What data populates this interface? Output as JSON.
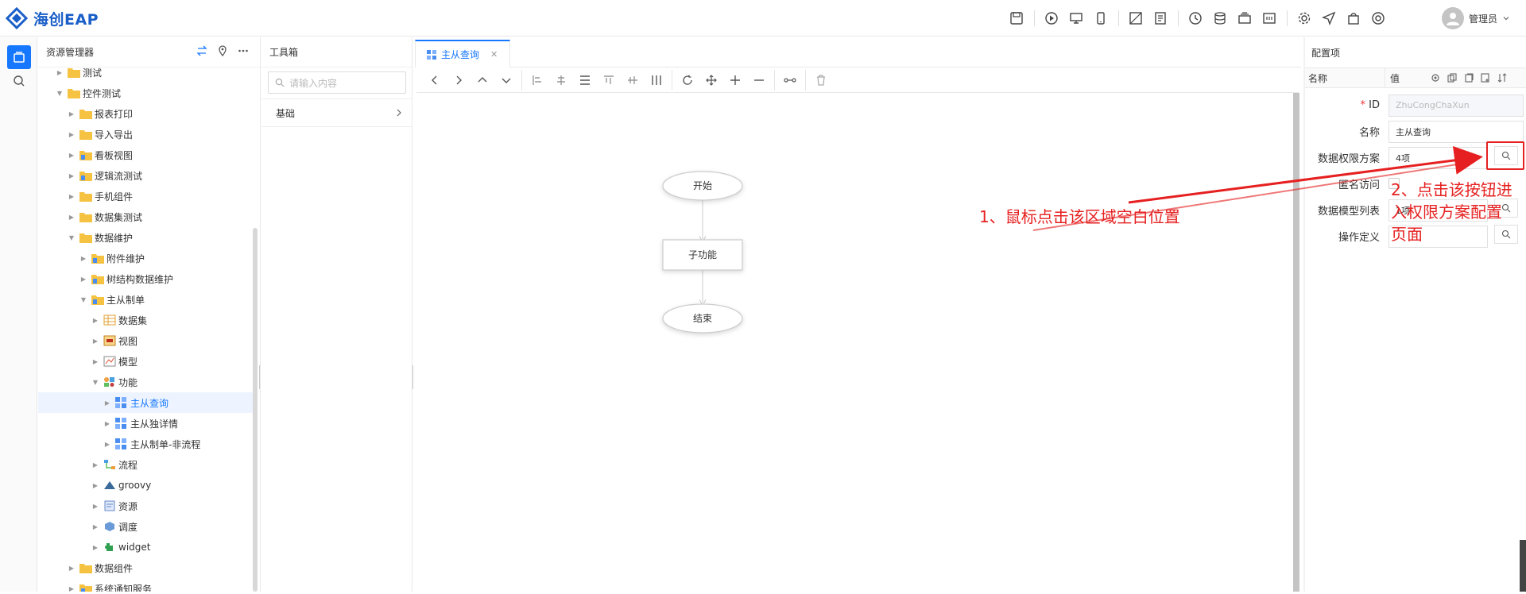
{
  "app": {
    "title": "海创EAP"
  },
  "header": {
    "user_name": "管理员",
    "dropdown_icon": "chevron-down-icon"
  },
  "resource_panel": {
    "title": "资源管理器",
    "tree": [
      {
        "label": "测试",
        "level": 1,
        "icon": "folder",
        "state": "collapsed"
      },
      {
        "label": "控件测试",
        "level": 1,
        "icon": "folder",
        "state": "expanded"
      },
      {
        "label": "报表打印",
        "level": 2,
        "icon": "folder",
        "state": "collapsed"
      },
      {
        "label": "导入导出",
        "level": 2,
        "icon": "folder",
        "state": "collapsed"
      },
      {
        "label": "看板视图",
        "level": 2,
        "icon": "folder-lock",
        "state": "collapsed"
      },
      {
        "label": "逻辑流测试",
        "level": 2,
        "icon": "folder-lock",
        "state": "collapsed"
      },
      {
        "label": "手机组件",
        "level": 2,
        "icon": "folder",
        "state": "collapsed"
      },
      {
        "label": "数据集测试",
        "level": 2,
        "icon": "folder",
        "state": "collapsed"
      },
      {
        "label": "数据维护",
        "level": 2,
        "icon": "folder",
        "state": "expanded"
      },
      {
        "label": "附件维护",
        "level": 3,
        "icon": "folder-lock",
        "state": "collapsed"
      },
      {
        "label": "树结构数据维护",
        "level": 3,
        "icon": "folder-lock",
        "state": "collapsed"
      },
      {
        "label": "主从制单",
        "level": 3,
        "icon": "folder-lock",
        "state": "expanded"
      },
      {
        "label": "数据集",
        "level": 4,
        "icon": "dataset",
        "state": "collapsed"
      },
      {
        "label": "视图",
        "level": 4,
        "icon": "view",
        "state": "collapsed"
      },
      {
        "label": "模型",
        "level": 4,
        "icon": "model",
        "state": "collapsed"
      },
      {
        "label": "功能",
        "level": 4,
        "icon": "function",
        "state": "expanded"
      },
      {
        "label": "主从查询",
        "level": 5,
        "icon": "grid",
        "state": "collapsed",
        "selected": true
      },
      {
        "label": "主从独详情",
        "level": 5,
        "icon": "grid",
        "state": "collapsed"
      },
      {
        "label": "主从制单-非流程",
        "level": 5,
        "icon": "grid",
        "state": "collapsed"
      },
      {
        "label": "流程",
        "level": 4,
        "icon": "flow",
        "state": "collapsed"
      },
      {
        "label": "groovy",
        "level": 4,
        "icon": "groovy",
        "state": "collapsed"
      },
      {
        "label": "资源",
        "level": 4,
        "icon": "resource",
        "state": "collapsed"
      },
      {
        "label": "调度",
        "level": 4,
        "icon": "schedule",
        "state": "collapsed"
      },
      {
        "label": "widget",
        "level": 4,
        "icon": "widget",
        "state": "collapsed"
      },
      {
        "label": "数据组件",
        "level": 2,
        "icon": "folder",
        "state": "collapsed"
      },
      {
        "label": "系统通知服务",
        "level": 2,
        "icon": "folder-lock",
        "state": "collapsed"
      }
    ]
  },
  "toolbox": {
    "title": "工具箱",
    "search_placeholder": "请输入内容",
    "group_label": "基础"
  },
  "editor": {
    "tab_label": "主从查询",
    "flow_nodes": {
      "start": "开始",
      "sub": "子功能",
      "end": "结束"
    }
  },
  "config": {
    "title": "配置项",
    "col_name": "名称",
    "col_value": "值",
    "rows": [
      {
        "label": "ID",
        "required": true,
        "value": "ZhuCongChaXun"
      },
      {
        "label": "名称",
        "value": "主从查询"
      },
      {
        "label": "数据权限方案",
        "value": "4项"
      },
      {
        "label": "匿名访问",
        "value": ""
      },
      {
        "label": "数据模型列表",
        "value": "1项"
      },
      {
        "label": "操作定义",
        "value": ""
      }
    ]
  },
  "annotations": {
    "step1": "1、鼠标点击该区域空白位置",
    "step2_line1": "2、点击该按钮进",
    "step2_line2": "入权限方案配置",
    "step2_line3": "页面"
  },
  "colors": {
    "accent": "#1677ff",
    "annotation": "#e62020",
    "brand": "#1a5fc8"
  }
}
